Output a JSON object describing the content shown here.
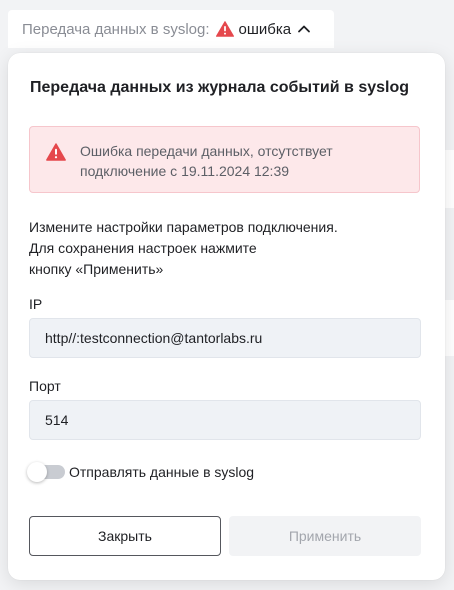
{
  "trigger": {
    "label": "Передача данных в syslog:",
    "status": "ошибка",
    "status_icon": "warning-triangle-icon",
    "chevron_icon": "chevron-up-icon"
  },
  "panel": {
    "title": "Передача данных из журнала событий в syslog",
    "alert": {
      "icon": "warning-triangle-icon",
      "text": "Ошибка передачи данных, отсутствует подключение с 19.11.2024 12:39"
    },
    "instructions": "Измените настройки параметров подключения.\nДля сохранения настроек нажмите\nкнопку «Применить»",
    "fields": {
      "ip": {
        "label": "IP",
        "value": "http//:testconnection@tantorlabs.ru"
      },
      "port": {
        "label": "Порт",
        "value": "514"
      }
    },
    "toggle": {
      "label": "Отправлять данные в syslog",
      "enabled": false
    },
    "buttons": {
      "close": "Закрыть",
      "apply": "Применить"
    }
  },
  "colors": {
    "error": "#e5484d",
    "alert_bg": "#fde8ea",
    "field_bg": "#eff2f6",
    "disabled_text": "#a3a6ad"
  }
}
